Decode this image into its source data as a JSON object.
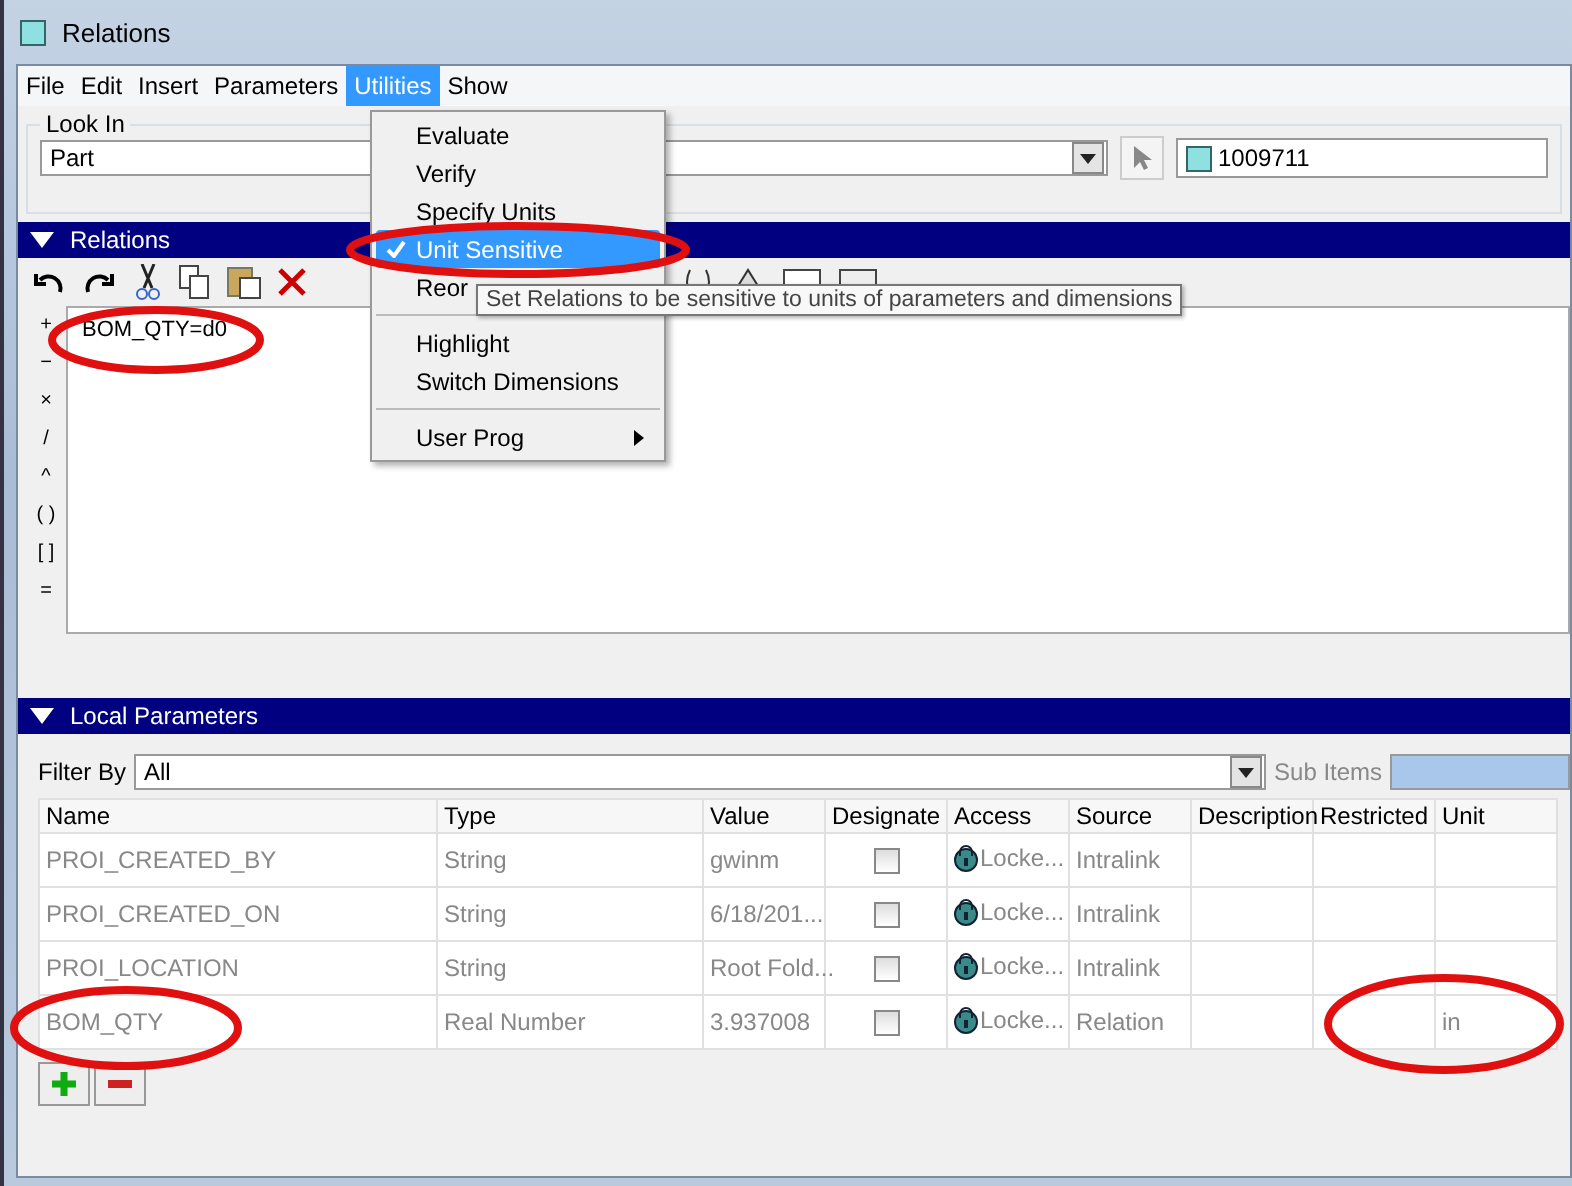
{
  "window": {
    "title": "Relations"
  },
  "menubar": [
    {
      "label": "File",
      "selected": false
    },
    {
      "label": "Edit",
      "selected": false
    },
    {
      "label": "Insert",
      "selected": false
    },
    {
      "label": "Parameters",
      "selected": false
    },
    {
      "label": "Utilities",
      "selected": true
    },
    {
      "label": "Show",
      "selected": false
    }
  ],
  "look_in": {
    "label": "Look In",
    "value": "Part",
    "model": "1009711"
  },
  "relations": {
    "title": "Relations",
    "operators": [
      "+",
      "−",
      "×",
      "/",
      "^",
      "( )",
      "[ ]",
      "="
    ],
    "text": "BOM_QTY=d0"
  },
  "menu": [
    {
      "kind": "item",
      "label": "Evaluate",
      "checked": false,
      "selected": false
    },
    {
      "kind": "item",
      "label": "Verify",
      "checked": false,
      "selected": false
    },
    {
      "kind": "item",
      "label": "Specify Units",
      "checked": false,
      "selected": false
    },
    {
      "kind": "item",
      "label": "Unit Sensitive",
      "checked": true,
      "selected": true
    },
    {
      "kind": "item",
      "label": "Reor",
      "checked": false,
      "selected": false
    },
    {
      "kind": "separator"
    },
    {
      "kind": "item",
      "label": "Highlight",
      "checked": false,
      "selected": false
    },
    {
      "kind": "item",
      "label": "Switch Dimensions",
      "checked": false,
      "selected": false
    },
    {
      "kind": "separator"
    },
    {
      "kind": "submenu",
      "label": "User Prog",
      "checked": false,
      "selected": false
    }
  ],
  "tooltip": "Set Relations to be sensitive to units of parameters and dimensions",
  "local_parameters": {
    "title": "Local Parameters",
    "filter_label": "Filter By",
    "filter_value": "All",
    "sub_items_label": "Sub Items",
    "columns": [
      "Name",
      "Type",
      "Value",
      "Designate",
      "Access",
      "Source",
      "Description",
      "Restricted",
      "Unit"
    ],
    "rows": [
      {
        "name": "PROI_CREATED_BY",
        "type": "String",
        "value": "gwinm",
        "designate": false,
        "access": "Locke...",
        "source": "Intralink",
        "unit": ""
      },
      {
        "name": "PROI_CREATED_ON",
        "type": "String",
        "value": "6/18/201...",
        "designate": false,
        "access": "Locke...",
        "source": "Intralink",
        "unit": ""
      },
      {
        "name": "PROI_LOCATION",
        "type": "String",
        "value": "Root Fold...",
        "designate": false,
        "access": "Locke...",
        "source": "Intralink",
        "unit": ""
      },
      {
        "name": "BOM_QTY",
        "type": "Real Number",
        "value": "3.937008",
        "designate": false,
        "access": "Locke...",
        "source": "Relation",
        "unit": "in"
      }
    ]
  }
}
